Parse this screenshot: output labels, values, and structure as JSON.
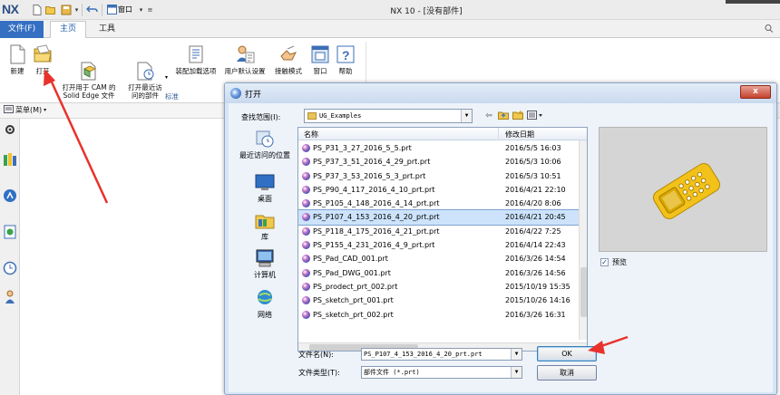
{
  "app": {
    "logo": "NX",
    "window_title": "NX 10 - [没有部件]",
    "quick_access": {
      "window_label": "窗口"
    }
  },
  "tabs": [
    {
      "label": "文件(F)"
    },
    {
      "label": "主页"
    },
    {
      "label": "工具"
    }
  ],
  "ribbon": {
    "buttons": [
      {
        "label": "新建"
      },
      {
        "label": "打开"
      },
      {
        "label": "打开用于 CAM 的\nSolid Edge 文件"
      },
      {
        "label": "打开最近访\n问的部件"
      },
      {
        "label": "装配加载选项"
      },
      {
        "label": "用户默认设置"
      },
      {
        "label": "接触模式"
      },
      {
        "label": "窗口"
      },
      {
        "label": "帮助"
      }
    ],
    "group_label": "标准"
  },
  "menubar": {
    "menu_label": "菜单(M)"
  },
  "dialog": {
    "title": "打开",
    "close_label": "x",
    "look_in_label": "查找范围(I):",
    "look_in_value": "UG_Examples",
    "places": [
      {
        "label": "最近访问的位置"
      },
      {
        "label": "桌面"
      },
      {
        "label": "库"
      },
      {
        "label": "计算机"
      },
      {
        "label": "网络"
      }
    ],
    "columns": {
      "name": "名称",
      "date": "修改日期"
    },
    "files": [
      {
        "name": "PS_P31_3_27_2016_5_5.prt",
        "date": "2016/5/5 16:03"
      },
      {
        "name": "PS_P37_3_51_2016_4_29_prt.prt",
        "date": "2016/5/3 10:06"
      },
      {
        "name": "PS_P37_3_53_2016_5_3_prt.prt",
        "date": "2016/5/3 10:51"
      },
      {
        "name": "PS_P90_4_117_2016_4_10_prt.prt",
        "date": "2016/4/21 22:10"
      },
      {
        "name": "PS_P105_4_148_2016_4_14_prt.prt",
        "date": "2016/4/20 8:06"
      },
      {
        "name": "PS_P107_4_153_2016_4_20_prt.prt",
        "date": "2016/4/21 20:45",
        "selected": true
      },
      {
        "name": "PS_P118_4_175_2016_4_21_prt.prt",
        "date": "2016/4/22 7:25"
      },
      {
        "name": "PS_P155_4_231_2016_4_9_prt.prt",
        "date": "2016/4/14 22:43"
      },
      {
        "name": "PS_Pad_CAD_001.prt",
        "date": "2016/3/26 14:54"
      },
      {
        "name": "PS_Pad_DWG_001.prt",
        "date": "2016/3/26 14:56"
      },
      {
        "name": "PS_prodect_prt_002.prt",
        "date": "2015/10/19 15:35"
      },
      {
        "name": "PS_sketch_prt_001.prt",
        "date": "2015/10/26 14:16"
      },
      {
        "name": "PS_sketch_prt_002.prt",
        "date": "2016/3/26 16:31"
      }
    ],
    "preview_label": "预览",
    "preview_checked": true,
    "filename_label": "文件名(N):",
    "filename_value": "PS_P107_4_153_2016_4_20_prt.prt",
    "filetype_label": "文件类型(T):",
    "filetype_value": "部件文件 (*.prt)",
    "ok_label": "OK",
    "cancel_label": "取消"
  },
  "colors": {
    "file_tab": "#356fc2",
    "annotation_arrow": "#e8322b",
    "selection": "#cce3fb"
  }
}
